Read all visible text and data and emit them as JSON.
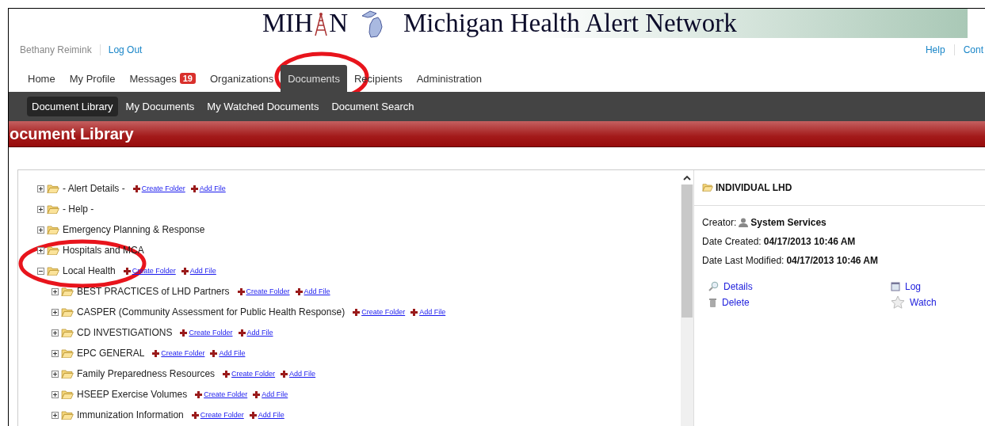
{
  "banner": {
    "logo_left": "MIH",
    "logo_right": "N",
    "title": "Michigan Health Alert Network"
  },
  "user_bar": {
    "user": "Bethany Reimink",
    "logout": "Log Out",
    "links": [
      "Help",
      "Cont"
    ]
  },
  "nav": [
    {
      "label": "Home",
      "selected": false
    },
    {
      "label": "My Profile",
      "selected": false
    },
    {
      "label": "Messages",
      "badge": "19",
      "selected": false
    },
    {
      "label": "Organizations",
      "selected": false
    },
    {
      "label": "Documents",
      "selected": true
    },
    {
      "label": "Recipients",
      "selected": false
    },
    {
      "label": "Administration",
      "selected": false
    }
  ],
  "subnav": [
    {
      "label": "Document Library",
      "selected": true
    },
    {
      "label": "My Documents",
      "selected": false
    },
    {
      "label": "My Watched Documents",
      "selected": false
    },
    {
      "label": "Document Search",
      "selected": false
    }
  ],
  "page_title": "ocument Library",
  "tree": [
    {
      "label": "- Alert Details -",
      "expanded": false,
      "actions": [
        "Create Folder",
        "Add File"
      ]
    },
    {
      "label": "- Help -",
      "expanded": false
    },
    {
      "label": "Emergency Planning & Response",
      "expanded": false
    },
    {
      "label": "Hospitals and MCA",
      "expanded": false
    },
    {
      "label": "Local Health",
      "expanded": true,
      "actions": [
        "Create Folder",
        "Add File"
      ],
      "children": [
        {
          "label": "BEST PRACTICES of LHD Partners",
          "expanded": false,
          "actions": [
            "Create Folder",
            "Add File"
          ]
        },
        {
          "label": "CASPER (Community Assessment for Public Health Response)",
          "expanded": false,
          "actions": [
            "Create Folder",
            "Add File"
          ]
        },
        {
          "label": "CD INVESTIGATIONS",
          "expanded": false,
          "actions": [
            "Create Folder",
            "Add File"
          ]
        },
        {
          "label": "EPC GENERAL",
          "expanded": false,
          "actions": [
            "Create Folder",
            "Add File"
          ]
        },
        {
          "label": "Family Preparedness Resources",
          "expanded": false,
          "actions": [
            "Create Folder",
            "Add File"
          ]
        },
        {
          "label": "HSEEP Exercise Volumes",
          "expanded": false,
          "actions": [
            "Create Folder",
            "Add File"
          ]
        },
        {
          "label": "Immunization Information",
          "expanded": false,
          "actions": [
            "Create Folder",
            "Add File"
          ]
        }
      ]
    }
  ],
  "details": {
    "title": "INDIVIDUAL LHD",
    "fields": [
      {
        "kind": "person",
        "label": "Creator:",
        "value": "System Services"
      },
      {
        "kind": "plain",
        "label": "Date Created:",
        "value": "04/17/2013 10:46 AM"
      },
      {
        "kind": "plain",
        "label": "Date Last Modified:",
        "value": "04/17/2013 10:46 AM"
      }
    ],
    "actions": [
      {
        "kind": "details",
        "label": "Details"
      },
      {
        "kind": "log",
        "label": "Log"
      },
      {
        "kind": "delete",
        "label": "Delete"
      },
      {
        "kind": "watch",
        "label": "Watch"
      }
    ]
  }
}
